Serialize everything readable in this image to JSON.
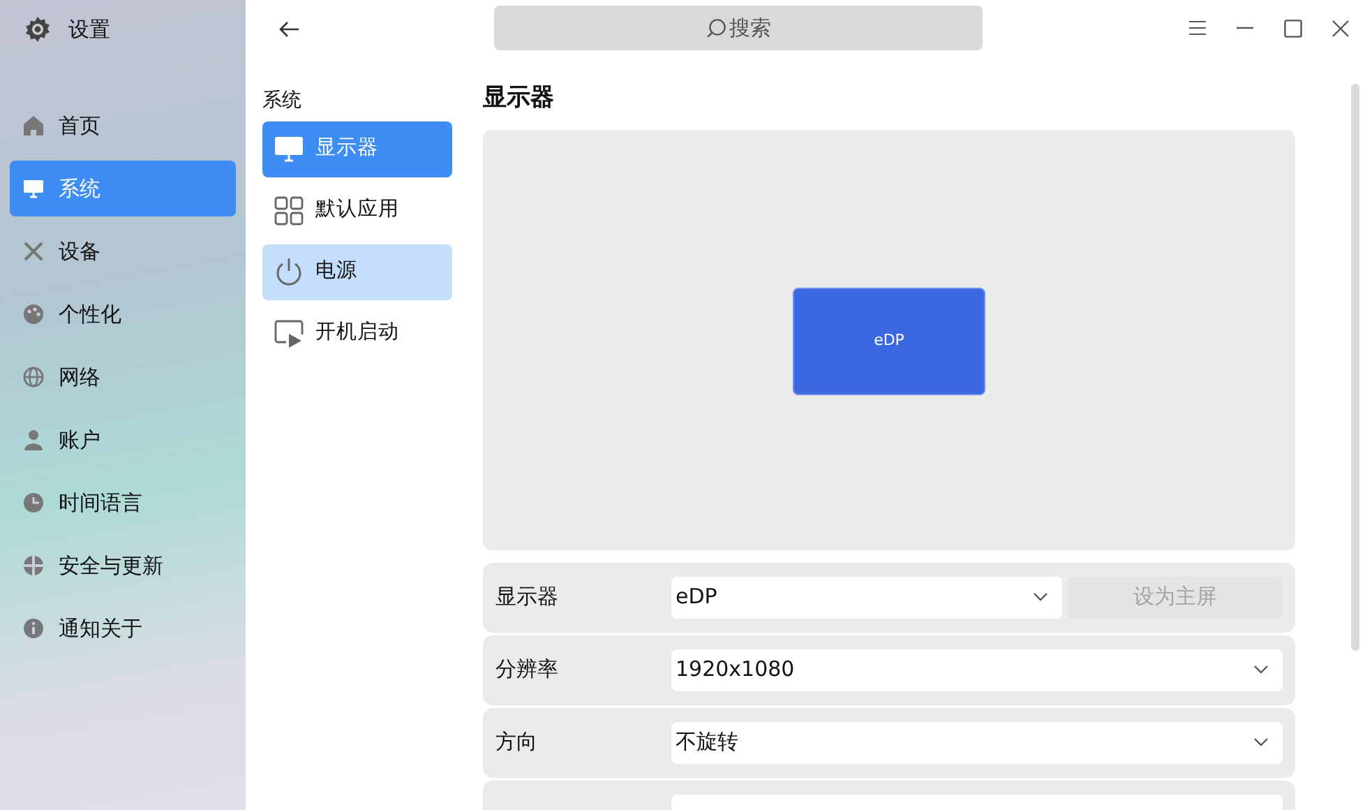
{
  "window": {
    "title": "设置"
  },
  "search": {
    "placeholder": "搜索"
  },
  "sidebar": {
    "items": [
      {
        "label": "首页",
        "selected": false
      },
      {
        "label": "系统",
        "selected": true
      },
      {
        "label": "设备",
        "selected": false
      },
      {
        "label": "个性化",
        "selected": false
      },
      {
        "label": "网络",
        "selected": false
      },
      {
        "label": "账户",
        "selected": false
      },
      {
        "label": "时间语言",
        "selected": false
      },
      {
        "label": "安全与更新",
        "selected": false
      },
      {
        "label": "通知关于",
        "selected": false
      }
    ]
  },
  "subnav": {
    "heading": "系统",
    "items": [
      {
        "label": "显示器",
        "selected": true,
        "hovered": false
      },
      {
        "label": "默认应用",
        "selected": false,
        "hovered": false
      },
      {
        "label": "电源",
        "selected": false,
        "hovered": true
      },
      {
        "label": "开机启动",
        "selected": false,
        "hovered": false
      }
    ]
  },
  "display": {
    "title": "显示器",
    "monitors": [
      {
        "label": "eDP"
      }
    ],
    "rows": [
      {
        "kind": "select-with-button",
        "label": "显示器",
        "value": "eDP",
        "button": {
          "label": "设为主屏",
          "disabled": true
        }
      },
      {
        "kind": "select",
        "label": "分辨率",
        "value": "1920x1080"
      },
      {
        "kind": "select",
        "label": "方向",
        "value": "不旋转"
      },
      {
        "kind": "cut"
      }
    ]
  }
}
